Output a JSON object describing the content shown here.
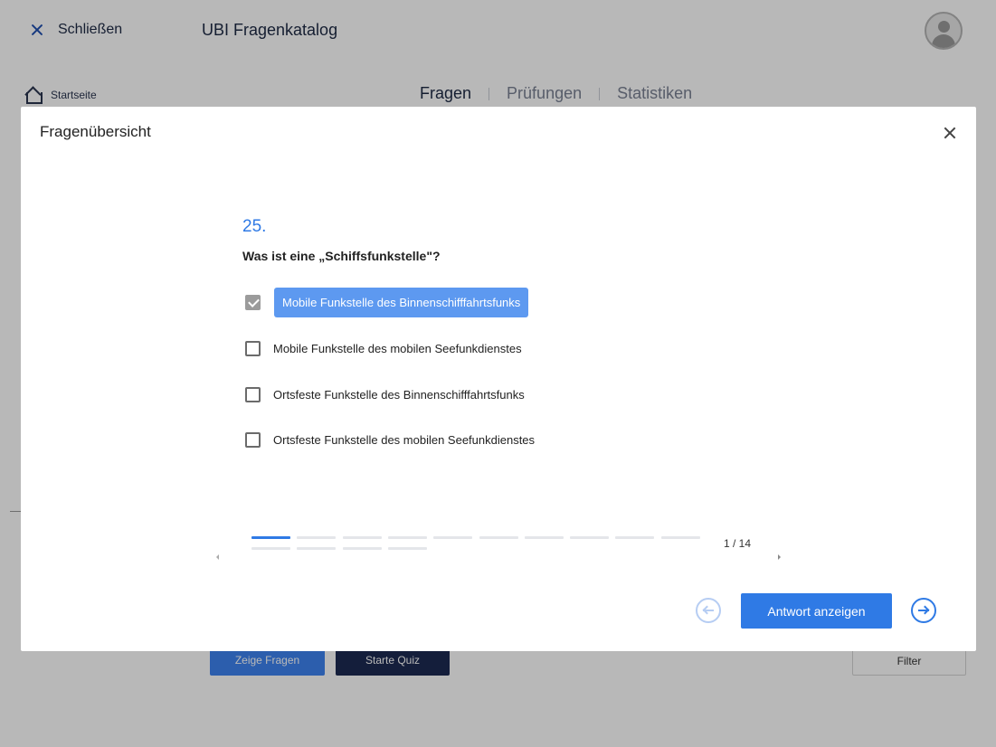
{
  "header": {
    "close_label": "Schließen",
    "app_title": "UBI Fragenkatalog"
  },
  "breadcrumb": {
    "home_label": "Startseite"
  },
  "nav": {
    "tabs": [
      {
        "label": "Fragen",
        "active": true
      },
      {
        "label": "Prüfungen",
        "active": false
      },
      {
        "label": "Statistiken",
        "active": false
      }
    ]
  },
  "background_buttons": {
    "show_questions": "Zeige Fragen",
    "start_quiz": "Starte Quiz",
    "filter": "Filter"
  },
  "modal": {
    "title": "Fragenübersicht",
    "question_number": "25.",
    "question_text": "Was ist eine „Schiffsfunkstelle\"?",
    "answers": [
      {
        "label": "Mobile Funkstelle des Binnenschifffahrtsfunks",
        "checked": true
      },
      {
        "label": "Mobile Funkstelle des mobilen Seefunkdienstes",
        "checked": false
      },
      {
        "label": "Ortsfeste Funkstelle des Binnenschifffahrtsfunks",
        "checked": false
      },
      {
        "label": "Ortsfeste Funkstelle des mobilen Seefunkdienstes",
        "checked": false
      }
    ],
    "progress": {
      "current": 1,
      "total": 14,
      "label": "1 / 14"
    },
    "show_answer_label": "Antwort anzeigen"
  },
  "colors": {
    "accent": "#2f7ae5",
    "selected_answer_bg": "#5d99f0",
    "dark_button": "#1d2a52"
  },
  "icons": {
    "close": "close-icon",
    "home": "home-icon",
    "avatar": "avatar-icon",
    "prev": "arrow-left-icon",
    "next": "arrow-right-icon"
  }
}
